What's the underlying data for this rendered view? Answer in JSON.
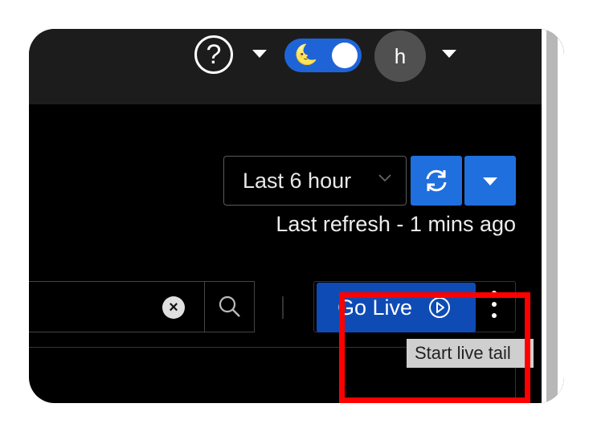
{
  "header": {
    "help_symbol": "?",
    "avatar_initial": "h",
    "theme_toggle": {
      "icon": "moon-icon",
      "state": "dark",
      "moon_glyph": "🌜"
    }
  },
  "toolbar": {
    "time_range": "Last 6 hour",
    "last_refresh": "Last refresh - 1 mins ago"
  },
  "search": {
    "clear_glyph": "×"
  },
  "live": {
    "go_live_label": "Go Live",
    "tooltip": "Start live tail"
  },
  "colors": {
    "accent_blue": "#1f6fde",
    "go_live_blue": "#0e4bb5",
    "highlight_red": "#ff0000",
    "background": "#000000"
  }
}
